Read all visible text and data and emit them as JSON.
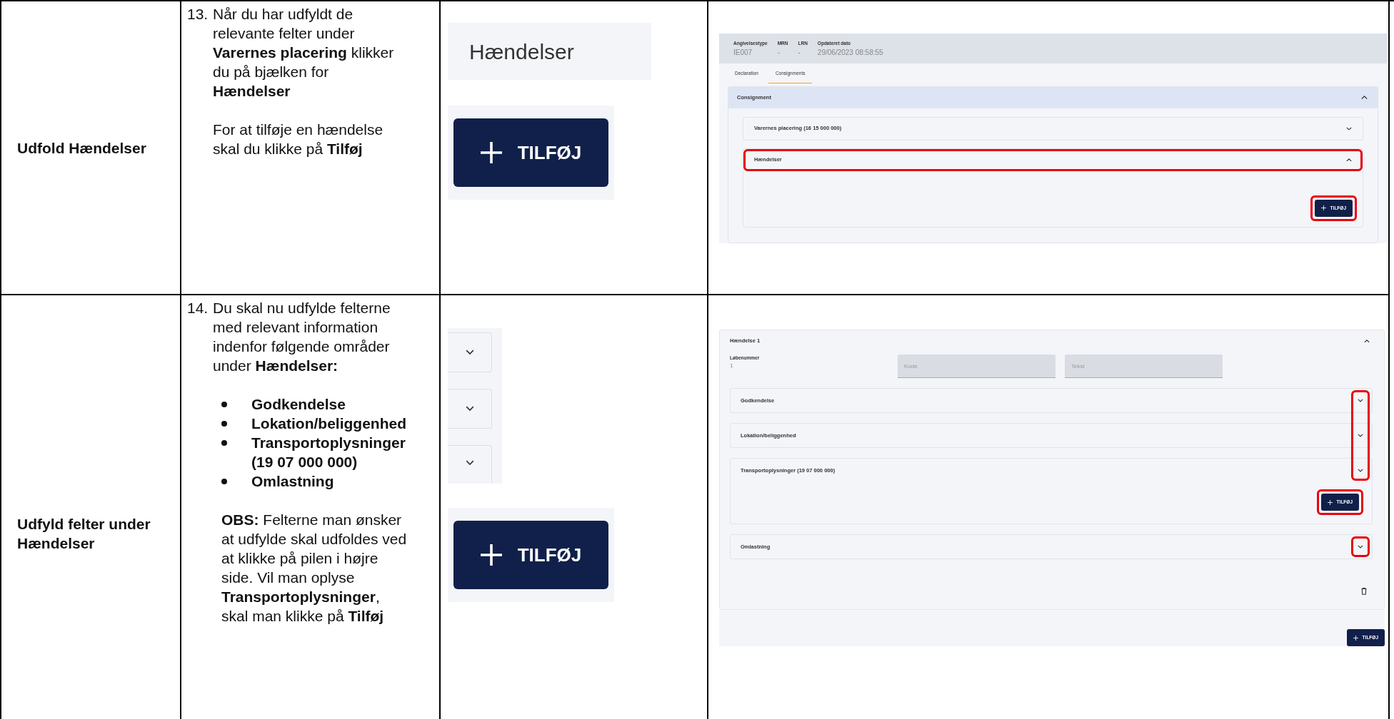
{
  "rows": [
    {
      "title": "Udfold Hændelser",
      "number": "13.",
      "blocks": [
        {
          "kind": "para",
          "text": "Når du har udfyldt de relevante felter under **Varernes placering** klikker du på bjælken for **Hændelser**"
        },
        {
          "kind": "para",
          "text": "For at tilføje en hændelse skal du klikke på **Tilføj**"
        }
      ],
      "snippets": [
        {
          "kind": "bar",
          "text": "Hændelser"
        },
        {
          "kind": "button",
          "label": "TILFØJ"
        }
      ],
      "screen": {
        "kind": "consignment",
        "header_fields": [
          {
            "label": "Angivelsestype",
            "value": "IE007"
          },
          {
            "label": "MRN",
            "value": "-"
          },
          {
            "label": "LRN",
            "value": "-"
          },
          {
            "label": "Opdateret dato",
            "value": "29/06/2023 08:58:55"
          }
        ],
        "tabs": [
          {
            "label": "Declaration",
            "selected": false
          },
          {
            "label": "Consignments",
            "selected": true
          }
        ],
        "panel": {
          "title": "Consignment",
          "expanded": true
        },
        "sections": [
          {
            "title": "Varernes placering (16 15 000 000)",
            "expanded": false,
            "highlighted": false
          },
          {
            "title": "Hændelser",
            "expanded": true,
            "highlighted": true,
            "button": {
              "label": "TILFØJ",
              "highlighted": true
            }
          }
        ]
      }
    },
    {
      "title": "Udfyld felter under Hændelser",
      "number": "14.",
      "blocks": [
        {
          "kind": "para",
          "text": "Du skal nu udfylde felterne med relevant information indenfor følgende områder under **Hændelser:**"
        },
        {
          "kind": "bullets",
          "items": [
            "Godkendelse",
            "Lokation/beliggenhed",
            "Transportoplysninger (19 07 000 000)",
            "Omlastning"
          ]
        },
        {
          "kind": "para",
          "text": "**OBS:** Felterne man ønsker at udfylde skal udfoldes ved at klikke på pilen i højre side. Vil man oplyse **Transportoplysninger**, skal man klikke på **Tilføj**"
        }
      ],
      "snippets": [
        {
          "kind": "chevrons",
          "items": [
            {
              "expanded": false
            },
            {
              "expanded": false
            },
            {
              "expanded": false
            }
          ]
        },
        {
          "kind": "button",
          "label": "TILFØJ"
        }
      ],
      "screen": {
        "kind": "event",
        "card": {
          "title": "Hændelse 1",
          "expanded": true
        },
        "field": {
          "label": "Løbenummer",
          "value": "1"
        },
        "inputs": [
          {
            "placeholder": "Kode"
          },
          {
            "placeholder": "Tekst"
          }
        ],
        "sections": [
          {
            "title": "Godkendelse",
            "expanded": false,
            "marked": true
          },
          {
            "title": "Lokation/beliggenhed",
            "expanded": false,
            "marked": true
          },
          {
            "title": "Transportoplysninger (19 07 000 000)",
            "expanded": false,
            "marked": true,
            "button": {
              "label": "TILFØJ",
              "highlighted": true
            }
          },
          {
            "title": "Omlastning",
            "expanded": false,
            "marked": true
          }
        ],
        "footer_button": {
          "label": "TILFØJ",
          "highlighted": false
        }
      }
    }
  ]
}
